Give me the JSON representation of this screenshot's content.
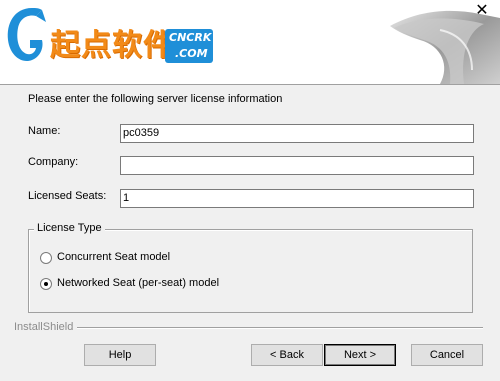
{
  "window": {
    "close_glyph": "✕",
    "logo": {
      "cn_text": "起点软件",
      "badge_top": "CNCRK",
      "badge_bottom": ".COM"
    }
  },
  "form": {
    "instruction": "Please enter the following server license information",
    "name_label": "Name:",
    "name_value": "pc0359",
    "company_label": "Company:",
    "company_value": "",
    "seats_label": "Licensed Seats:",
    "seats_value": "1"
  },
  "license_type": {
    "title": "License Type",
    "options": [
      {
        "label": "Concurrent Seat model",
        "selected": false
      },
      {
        "label": "Networked Seat (per-seat) model",
        "selected": true
      }
    ]
  },
  "footer": {
    "brand": "InstallShield",
    "help_label": "Help",
    "back_label": "< Back",
    "next_label": "Next >",
    "cancel_label": "Cancel"
  },
  "colors": {
    "accent_orange": "#f28a18",
    "badge_blue": "#1f8fd8",
    "dialog_bg": "#f0f0f0"
  }
}
